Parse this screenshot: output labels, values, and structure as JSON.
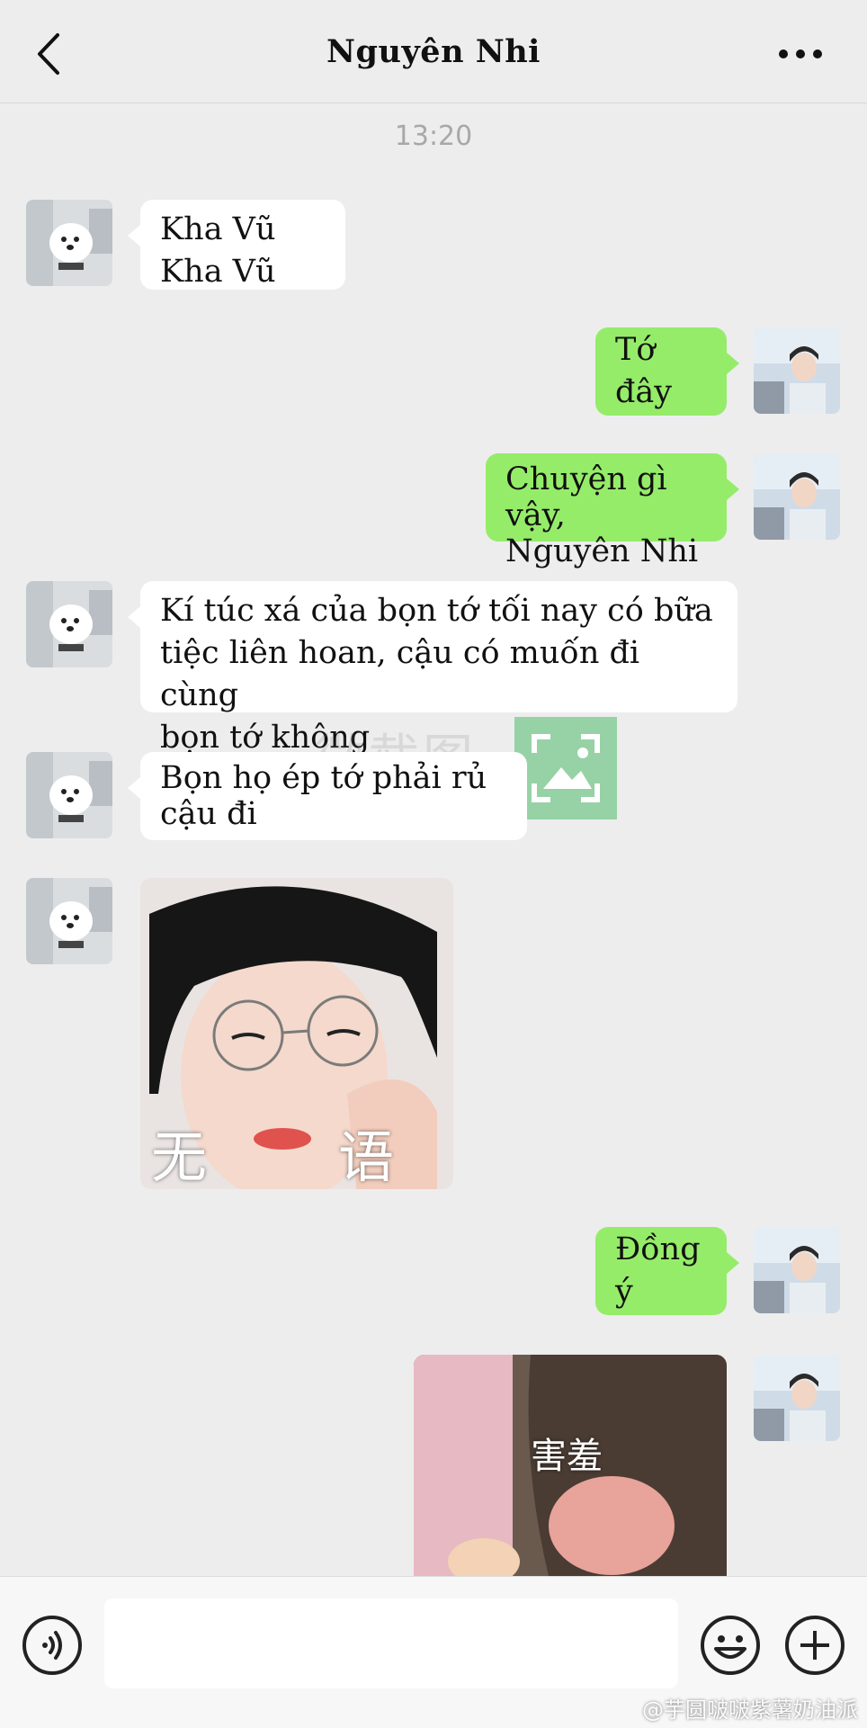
{
  "header": {
    "title": "Nguyên Nhi"
  },
  "timestamp": "13:20",
  "messages": [
    {
      "side": "in",
      "lines": [
        "Kha Vũ",
        "Kha Vũ"
      ]
    },
    {
      "side": "out",
      "lines": [
        "Tớ đây"
      ]
    },
    {
      "side": "out",
      "lines": [
        "Chuyện gì vậy,",
        "Nguyên Nhi"
      ]
    },
    {
      "side": "in",
      "lines": [
        "Kí túc xá của bọn tớ tối nay có bữa",
        "tiệc liên hoan, cậu có muốn đi cùng",
        "bọn tớ không"
      ]
    },
    {
      "side": "in",
      "lines": [
        "Bọn họ ép tớ phải rủ",
        "cậu đi"
      ]
    },
    {
      "side": "in",
      "sticker": {
        "caption_left": "无",
        "caption_right": "语"
      }
    },
    {
      "side": "out",
      "lines": [
        "Đồng ý"
      ]
    },
    {
      "side": "out",
      "sticker": {
        "caption": "害羞"
      }
    }
  ],
  "watermark": {
    "text": "微截图"
  },
  "input": {
    "value": "",
    "placeholder": ""
  },
  "footer_mark": "@芋圆啵啵紫薯奶油派",
  "colors": {
    "outgoing_bubble": "#95ec69",
    "incoming_bubble": "#ffffff",
    "background": "#ededed"
  },
  "icons": [
    "back-icon",
    "more-icon",
    "voice-icon",
    "emoji-icon",
    "plus-icon"
  ]
}
